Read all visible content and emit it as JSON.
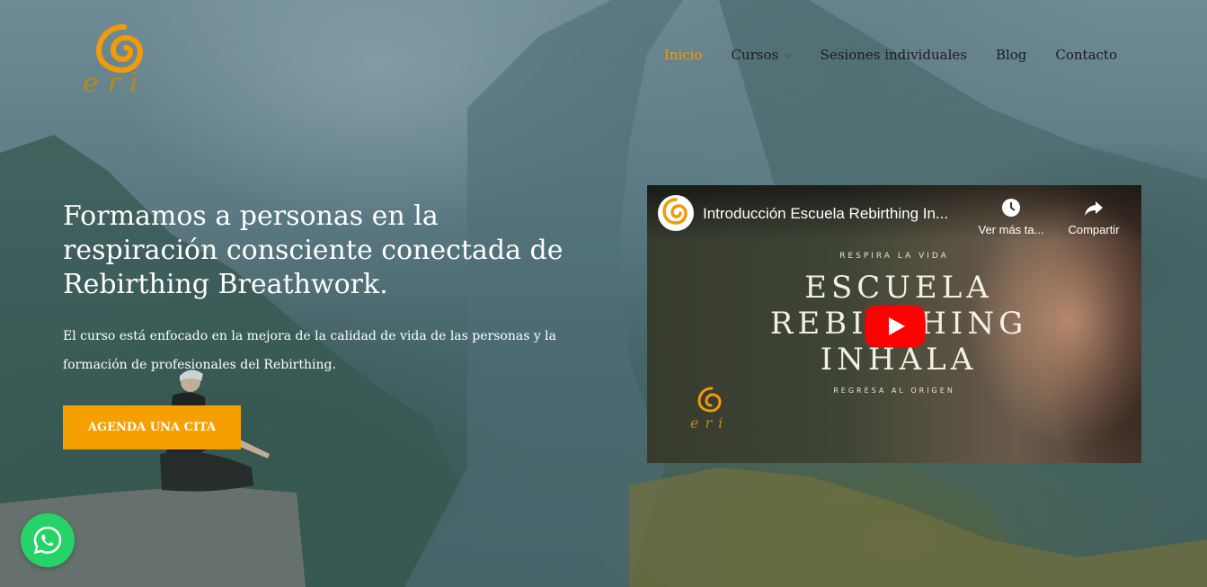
{
  "logo": {
    "text": "eri",
    "alt_icon": "spiral-logo-icon"
  },
  "nav": {
    "items": [
      {
        "label": "Inicio",
        "active": true
      },
      {
        "label": "Cursos",
        "has_dropdown": true
      },
      {
        "label": "Sesiones individuales"
      },
      {
        "label": "Blog"
      },
      {
        "label": "Contacto"
      }
    ]
  },
  "hero": {
    "title": "Formamos a personas en la respiración consciente conectada de Rebirthing Breathwork.",
    "subtitle": "El curso está enfocado en la mejora de la calidad de vida de las personas y la formación de profesionales del Rebirthing.",
    "cta_label": "AGENDA UNA CITA"
  },
  "video": {
    "title": "Introducción Escuela Rebirthing In...",
    "watch_later_label": "Ver más ta...",
    "share_label": "Compartir",
    "overlay_top": "RESPIRA LA VIDA",
    "overlay_line1": "ESCUELA",
    "overlay_line2": "REBIRTHING",
    "overlay_line3": "INHALA",
    "overlay_bottom": "REGRESA AL ORIGEN",
    "overlay_logo_text": "eri"
  },
  "colors": {
    "accent": "#f5a000",
    "nav_active": "#f29b05",
    "whatsapp": "#25d366"
  }
}
